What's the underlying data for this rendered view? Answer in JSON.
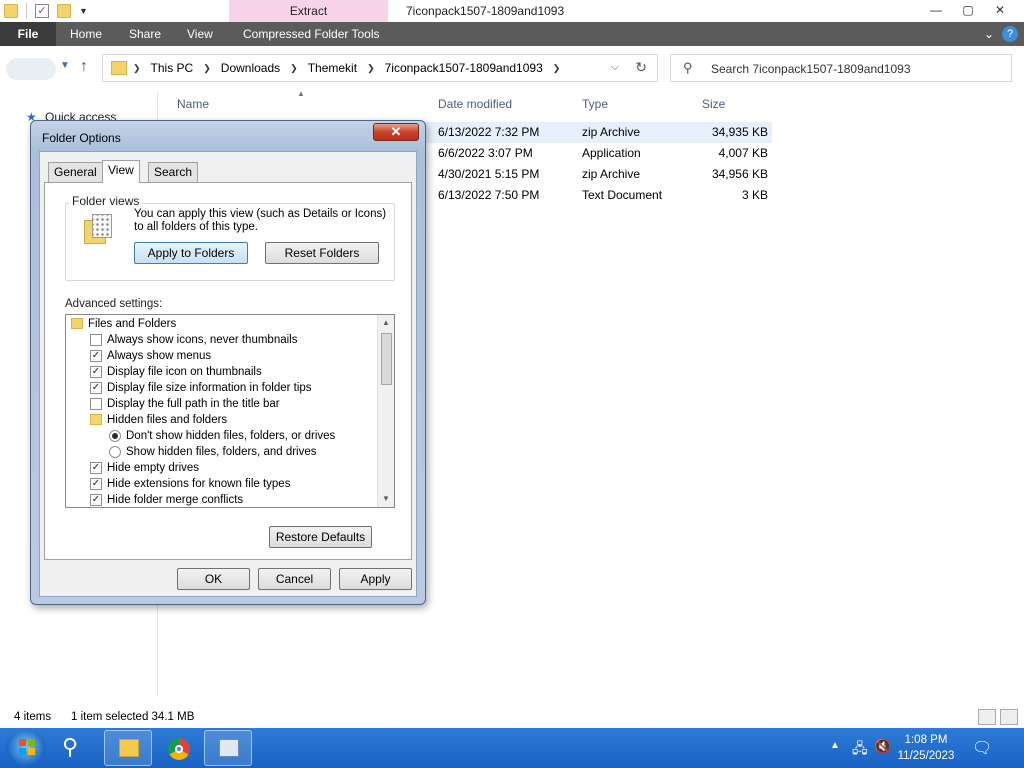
{
  "window": {
    "title": "7iconpack1507-1809and1093",
    "context_tab": "Extract",
    "controls": {
      "minimize": "—",
      "maximize": "▢",
      "close": "✕"
    }
  },
  "ribbon": {
    "tabs": [
      "File",
      "Home",
      "Share",
      "View",
      "Compressed Folder Tools"
    ]
  },
  "address": {
    "crumbs": [
      "This PC",
      "Downloads",
      "Themekit",
      "7iconpack1507-1809and1093"
    ],
    "search_placeholder": "Search 7iconpack1507-1809and1093"
  },
  "navpane": {
    "quick_access": "Quick access"
  },
  "columns": [
    "Name",
    "Date modified",
    "Type",
    "Size"
  ],
  "files": [
    {
      "date": "6/13/2022 7:32 PM",
      "type": "zip Archive",
      "size": "34,935 KB",
      "selected": true
    },
    {
      "date": "6/6/2022 3:07 PM",
      "type": "Application",
      "size": "4,007 KB",
      "selected": false
    },
    {
      "date": "4/30/2021 5:15 PM",
      "type": "zip Archive",
      "size": "34,956 KB",
      "selected": false
    },
    {
      "date": "6/13/2022 7:50 PM",
      "type": "Text Document",
      "size": "3 KB",
      "selected": false
    }
  ],
  "status": {
    "count": "4 items",
    "selection": "1 item selected  34.1 MB"
  },
  "dialog": {
    "title": "Folder Options",
    "tabs": [
      "General",
      "View",
      "Search"
    ],
    "active_tab": "View",
    "folder_views": {
      "label": "Folder views",
      "text": "You can apply this view (such as Details or Icons) to all folders of this type.",
      "apply_button": "Apply to Folders",
      "reset_button": "Reset Folders"
    },
    "advanced_label": "Advanced settings:",
    "settings": [
      {
        "kind": "folder",
        "level": 0,
        "label": "Files and Folders"
      },
      {
        "kind": "check",
        "level": 1,
        "label": "Always show icons, never thumbnails",
        "checked": false
      },
      {
        "kind": "check",
        "level": 1,
        "label": "Always show menus",
        "checked": true
      },
      {
        "kind": "check",
        "level": 1,
        "label": "Display file icon on thumbnails",
        "checked": true
      },
      {
        "kind": "check",
        "level": 1,
        "label": "Display file size information in folder tips",
        "checked": true
      },
      {
        "kind": "check",
        "level": 1,
        "label": "Display the full path in the title bar",
        "checked": false
      },
      {
        "kind": "folder",
        "level": 1,
        "label": "Hidden files and folders"
      },
      {
        "kind": "radio",
        "level": 2,
        "label": "Don't show hidden files, folders, or drives",
        "checked": true
      },
      {
        "kind": "radio",
        "level": 2,
        "label": "Show hidden files, folders, and drives",
        "checked": false
      },
      {
        "kind": "check",
        "level": 1,
        "label": "Hide empty drives",
        "checked": true
      },
      {
        "kind": "check",
        "level": 1,
        "label": "Hide extensions for known file types",
        "checked": true
      },
      {
        "kind": "check",
        "level": 1,
        "label": "Hide folder merge conflicts",
        "checked": true
      }
    ],
    "restore_button": "Restore Defaults",
    "ok_button": "OK",
    "cancel_button": "Cancel",
    "apply_button": "Apply"
  },
  "taskbar": {
    "time": "1:08 PM",
    "date": "11/25/2023"
  },
  "colors": {
    "ribbon": "#5b5b5b",
    "context_tab": "#f7d3ea",
    "taskbar": "#1f6fd0",
    "selection": "#e5f0fb"
  }
}
